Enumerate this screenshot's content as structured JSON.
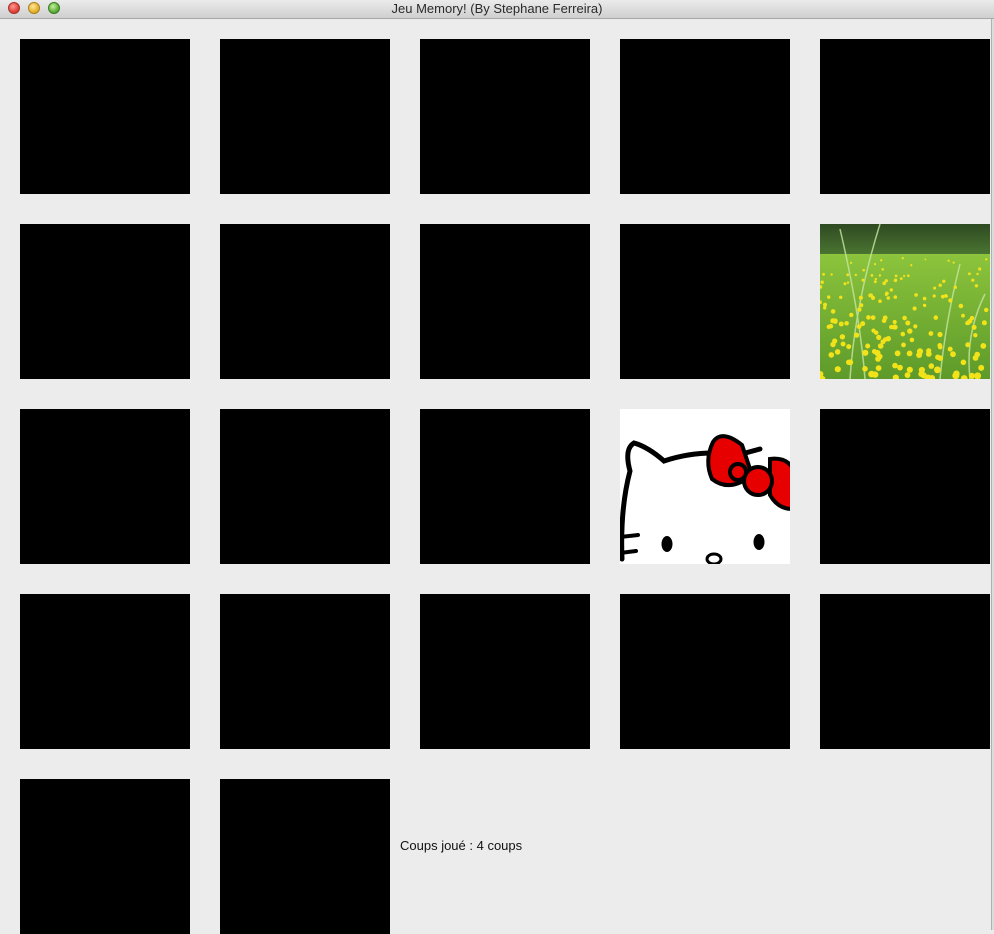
{
  "window": {
    "title": "Jeu Memory! (By Stephane Ferreira)"
  },
  "board": {
    "cards": [
      {
        "row": 1,
        "col": 1,
        "state": "face-down"
      },
      {
        "row": 1,
        "col": 2,
        "state": "face-down"
      },
      {
        "row": 1,
        "col": 3,
        "state": "face-down"
      },
      {
        "row": 1,
        "col": 4,
        "state": "face-down"
      },
      {
        "row": 1,
        "col": 5,
        "state": "face-down"
      },
      {
        "row": 2,
        "col": 1,
        "state": "face-down"
      },
      {
        "row": 2,
        "col": 2,
        "state": "face-down"
      },
      {
        "row": 2,
        "col": 3,
        "state": "face-down"
      },
      {
        "row": 2,
        "col": 4,
        "state": "face-down"
      },
      {
        "row": 2,
        "col": 5,
        "state": "face-up",
        "image": "flower-meadow"
      },
      {
        "row": 3,
        "col": 1,
        "state": "face-down"
      },
      {
        "row": 3,
        "col": 2,
        "state": "face-down"
      },
      {
        "row": 3,
        "col": 3,
        "state": "face-down"
      },
      {
        "row": 3,
        "col": 4,
        "state": "face-up",
        "image": "hello-kitty"
      },
      {
        "row": 3,
        "col": 5,
        "state": "face-down"
      },
      {
        "row": 4,
        "col": 1,
        "state": "face-down"
      },
      {
        "row": 4,
        "col": 2,
        "state": "face-down"
      },
      {
        "row": 4,
        "col": 3,
        "state": "face-down"
      },
      {
        "row": 4,
        "col": 4,
        "state": "face-down"
      },
      {
        "row": 4,
        "col": 5,
        "state": "face-down"
      },
      {
        "row": 5,
        "col": 1,
        "state": "face-down"
      },
      {
        "row": 5,
        "col": 2,
        "state": "face-down"
      }
    ]
  },
  "status": {
    "moves_text": "Coups joué : 4 coups"
  },
  "colors": {
    "card_back": "#000000",
    "background": "#ececec",
    "bow": "#e60000"
  }
}
